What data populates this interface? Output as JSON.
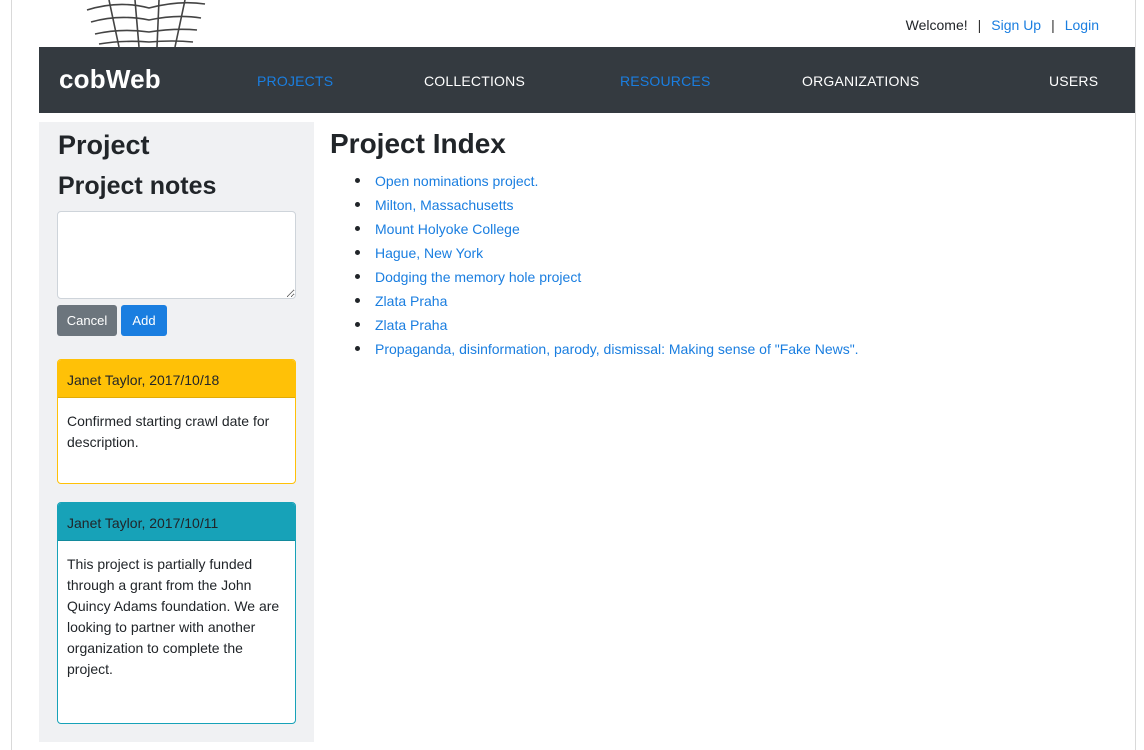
{
  "header": {
    "welcome": "Welcome!",
    "separator": "|",
    "signup_label": "Sign Up",
    "login_label": "Login",
    "logo_icon": "spiderweb-logo-icon"
  },
  "navbar": {
    "brand": "cobWeb",
    "items": [
      {
        "label": "PROJECTS",
        "active": true
      },
      {
        "label": "COLLECTIONS",
        "active": false
      },
      {
        "label": "RESOURCES",
        "active": true
      },
      {
        "label": "ORGANIZATIONS",
        "active": false
      },
      {
        "label": "USERS",
        "active": false
      }
    ]
  },
  "sidebar": {
    "title": "Project",
    "notes_title": "Project notes",
    "notes_value": "",
    "cancel_label": "Cancel",
    "add_label": "Add",
    "notes": [
      {
        "header": "Janet Taylor, 2017/10/18",
        "body": "Confirmed starting crawl date for description.",
        "style": "warning"
      },
      {
        "header": "Janet Taylor, 2017/10/11",
        "body": "This project is partially funded through a grant from the John Quincy Adams foundation. We are looking to partner with another organization to complete the project.",
        "style": "info"
      }
    ]
  },
  "main": {
    "title": "Project Index",
    "projects": [
      "Open nominations project.",
      "Milton, Massachusetts",
      "Mount Holyoke College",
      "Hague, New York",
      "Dodging the memory hole project",
      "Zlata Praha",
      "Zlata Praha",
      "Propaganda, disinformation, parody, dismissal: Making sense of \"Fake News\"."
    ]
  },
  "colors": {
    "navbar_bg": "#343a40",
    "link": "#1a7ee0",
    "warning": "#ffc107",
    "info": "#17a2b8",
    "secondary": "#6c757d",
    "sidebar_bg": "#f0f1f3"
  }
}
